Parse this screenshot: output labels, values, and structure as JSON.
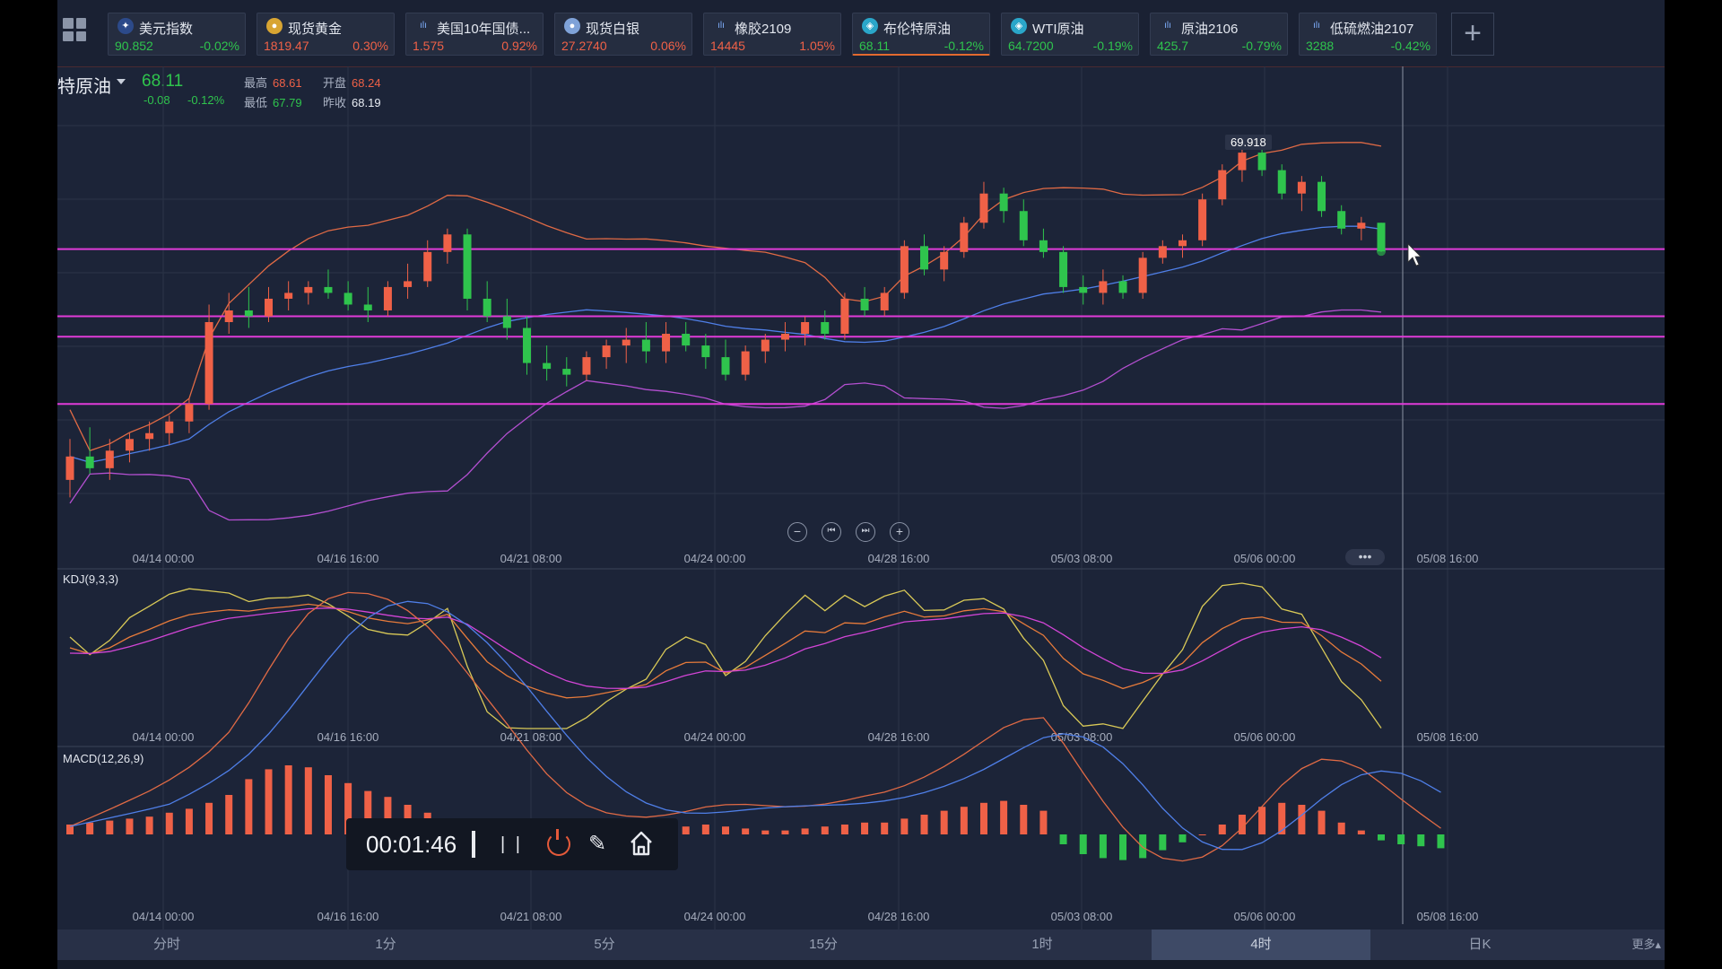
{
  "tickers": [
    {
      "name": "美元指数",
      "price": "90.852",
      "change": "-0.02%",
      "dir": "dn",
      "icon": "us-flag-icon"
    },
    {
      "name": "现货黄金",
      "price": "1819.47",
      "change": "0.30%",
      "dir": "up",
      "icon": "gold-coin-icon"
    },
    {
      "name": "美国10年国债...",
      "price": "1.575",
      "change": "0.92%",
      "dir": "up",
      "icon": "bar-chart-icon"
    },
    {
      "name": "现货白银",
      "price": "27.2740",
      "change": "0.06%",
      "dir": "up",
      "icon": "silver-coin-icon"
    },
    {
      "name": "橡胶2109",
      "price": "14445",
      "change": "1.05%",
      "dir": "up",
      "icon": "bar-chart-icon"
    },
    {
      "name": "布伦特原油",
      "price": "68.11",
      "change": "-0.12%",
      "dir": "dn",
      "icon": "oil-icon",
      "active": true
    },
    {
      "name": "WTI原油",
      "price": "64.7200",
      "change": "-0.19%",
      "dir": "dn",
      "icon": "oil-icon"
    },
    {
      "name": "原油2106",
      "price": "425.7",
      "change": "-0.79%",
      "dir": "dn",
      "icon": "bar-chart-icon"
    },
    {
      "name": "低硫燃油2107",
      "price": "3288",
      "change": "-0.42%",
      "dir": "dn",
      "icon": "bar-chart-icon"
    }
  ],
  "header": {
    "symbol": "特原油",
    "last": "68.11",
    "change": "-0.08",
    "change_pct": "-0.12%",
    "high_label": "最高",
    "high": "68.61",
    "open_label": "开盘",
    "open": "68.24",
    "low_label": "最低",
    "low": "67.79",
    "prev_label": "昨收",
    "prev": "68.19"
  },
  "chart_data": {
    "type": "candlestick",
    "title": "",
    "time_labels": [
      "04/14 00:00",
      "04/16 16:00",
      "04/21 08:00",
      "04/24 00:00",
      "04/28 16:00",
      "05/03 08:00",
      "05/06 00:00",
      "05/08 16:00"
    ],
    "max_label": "69.918",
    "indicators": {
      "kdj": "KDJ(9,3,3)",
      "macd": "MACD(12,26,9)"
    },
    "horizontal_lines_color": "#e03bd8",
    "up_color": "#ef6147",
    "down_color": "#2fc44d",
    "candles": [
      {
        "o": 64.2,
        "h": 64.9,
        "l": 63.9,
        "c": 64.6
      },
      {
        "o": 64.6,
        "h": 65.1,
        "l": 64.3,
        "c": 64.4
      },
      {
        "o": 64.4,
        "h": 64.9,
        "l": 64.2,
        "c": 64.7
      },
      {
        "o": 64.7,
        "h": 65.0,
        "l": 64.5,
        "c": 64.9
      },
      {
        "o": 64.9,
        "h": 65.2,
        "l": 64.7,
        "c": 65.0
      },
      {
        "o": 65.0,
        "h": 65.3,
        "l": 64.8,
        "c": 65.2
      },
      {
        "o": 65.2,
        "h": 65.6,
        "l": 65.0,
        "c": 65.5
      },
      {
        "o": 65.5,
        "h": 67.2,
        "l": 65.4,
        "c": 66.9
      },
      {
        "o": 66.9,
        "h": 67.4,
        "l": 66.7,
        "c": 67.1
      },
      {
        "o": 67.1,
        "h": 67.5,
        "l": 66.8,
        "c": 67.0
      },
      {
        "o": 67.0,
        "h": 67.5,
        "l": 66.9,
        "c": 67.3
      },
      {
        "o": 67.3,
        "h": 67.6,
        "l": 67.1,
        "c": 67.4
      },
      {
        "o": 67.4,
        "h": 67.6,
        "l": 67.2,
        "c": 67.5
      },
      {
        "o": 67.5,
        "h": 67.8,
        "l": 67.3,
        "c": 67.4
      },
      {
        "o": 67.4,
        "h": 67.6,
        "l": 67.1,
        "c": 67.2
      },
      {
        "o": 67.2,
        "h": 67.5,
        "l": 66.9,
        "c": 67.1
      },
      {
        "o": 67.1,
        "h": 67.6,
        "l": 67.0,
        "c": 67.5
      },
      {
        "o": 67.5,
        "h": 67.9,
        "l": 67.3,
        "c": 67.6
      },
      {
        "o": 67.6,
        "h": 68.3,
        "l": 67.5,
        "c": 68.1
      },
      {
        "o": 68.1,
        "h": 68.5,
        "l": 67.9,
        "c": 68.4
      },
      {
        "o": 68.4,
        "h": 68.5,
        "l": 67.1,
        "c": 67.3
      },
      {
        "o": 67.3,
        "h": 67.6,
        "l": 66.9,
        "c": 67.0
      },
      {
        "o": 67.0,
        "h": 67.3,
        "l": 66.6,
        "c": 66.8
      },
      {
        "o": 66.8,
        "h": 67.0,
        "l": 66.0,
        "c": 66.2
      },
      {
        "o": 66.2,
        "h": 66.5,
        "l": 65.9,
        "c": 66.1
      },
      {
        "o": 66.1,
        "h": 66.3,
        "l": 65.8,
        "c": 66.0
      },
      {
        "o": 66.0,
        "h": 66.4,
        "l": 65.9,
        "c": 66.3
      },
      {
        "o": 66.3,
        "h": 66.6,
        "l": 66.1,
        "c": 66.5
      },
      {
        "o": 66.5,
        "h": 66.8,
        "l": 66.2,
        "c": 66.6
      },
      {
        "o": 66.6,
        "h": 66.9,
        "l": 66.2,
        "c": 66.4
      },
      {
        "o": 66.4,
        "h": 66.9,
        "l": 66.2,
        "c": 66.7
      },
      {
        "o": 66.7,
        "h": 66.9,
        "l": 66.4,
        "c": 66.5
      },
      {
        "o": 66.5,
        "h": 66.7,
        "l": 66.1,
        "c": 66.3
      },
      {
        "o": 66.3,
        "h": 66.6,
        "l": 65.9,
        "c": 66.0
      },
      {
        "o": 66.0,
        "h": 66.5,
        "l": 65.9,
        "c": 66.4
      },
      {
        "o": 66.4,
        "h": 66.7,
        "l": 66.2,
        "c": 66.6
      },
      {
        "o": 66.6,
        "h": 66.9,
        "l": 66.4,
        "c": 66.7
      },
      {
        "o": 66.7,
        "h": 67.0,
        "l": 66.5,
        "c": 66.9
      },
      {
        "o": 66.9,
        "h": 67.1,
        "l": 66.6,
        "c": 66.7
      },
      {
        "o": 66.7,
        "h": 67.4,
        "l": 66.6,
        "c": 67.3
      },
      {
        "o": 67.3,
        "h": 67.5,
        "l": 67.0,
        "c": 67.1
      },
      {
        "o": 67.1,
        "h": 67.5,
        "l": 67.0,
        "c": 67.4
      },
      {
        "o": 67.4,
        "h": 68.3,
        "l": 67.3,
        "c": 68.2
      },
      {
        "o": 68.2,
        "h": 68.4,
        "l": 67.7,
        "c": 67.8
      },
      {
        "o": 67.8,
        "h": 68.2,
        "l": 67.6,
        "c": 68.1
      },
      {
        "o": 68.1,
        "h": 68.7,
        "l": 68.0,
        "c": 68.6
      },
      {
        "o": 68.6,
        "h": 69.3,
        "l": 68.5,
        "c": 69.1
      },
      {
        "o": 69.1,
        "h": 69.2,
        "l": 68.6,
        "c": 68.8
      },
      {
        "o": 68.8,
        "h": 69.0,
        "l": 68.2,
        "c": 68.3
      },
      {
        "o": 68.3,
        "h": 68.5,
        "l": 68.0,
        "c": 68.1
      },
      {
        "o": 68.1,
        "h": 68.2,
        "l": 67.4,
        "c": 67.5
      },
      {
        "o": 67.5,
        "h": 67.7,
        "l": 67.2,
        "c": 67.4
      },
      {
        "o": 67.4,
        "h": 67.8,
        "l": 67.2,
        "c": 67.6
      },
      {
        "o": 67.6,
        "h": 67.7,
        "l": 67.3,
        "c": 67.4
      },
      {
        "o": 67.4,
        "h": 68.1,
        "l": 67.3,
        "c": 68.0
      },
      {
        "o": 68.0,
        "h": 68.3,
        "l": 67.9,
        "c": 68.2
      },
      {
        "o": 68.2,
        "h": 68.4,
        "l": 68.0,
        "c": 68.3
      },
      {
        "o": 68.3,
        "h": 69.1,
        "l": 68.2,
        "c": 69.0
      },
      {
        "o": 69.0,
        "h": 69.6,
        "l": 68.9,
        "c": 69.5
      },
      {
        "o": 69.5,
        "h": 69.9,
        "l": 69.3,
        "c": 69.8
      },
      {
        "o": 69.8,
        "h": 69.9,
        "l": 69.4,
        "c": 69.5
      },
      {
        "o": 69.5,
        "h": 69.6,
        "l": 69.0,
        "c": 69.1
      },
      {
        "o": 69.1,
        "h": 69.4,
        "l": 68.8,
        "c": 69.3
      },
      {
        "o": 69.3,
        "h": 69.4,
        "l": 68.7,
        "c": 68.8
      },
      {
        "o": 68.8,
        "h": 68.9,
        "l": 68.4,
        "c": 68.5
      },
      {
        "o": 68.5,
        "h": 68.7,
        "l": 68.3,
        "c": 68.6
      },
      {
        "o": 68.6,
        "h": 68.6,
        "l": 68.1,
        "c": 68.11
      }
    ],
    "price_lines": [
      68.15,
      67.0,
      66.65,
      65.5
    ],
    "macd_hist": [
      0.05,
      0.06,
      0.07,
      0.08,
      0.09,
      0.11,
      0.13,
      0.16,
      0.2,
      0.28,
      0.33,
      0.35,
      0.34,
      0.3,
      0.26,
      0.22,
      0.19,
      0.15,
      0.11,
      0.06,
      0.02,
      -0.01,
      -0.03,
      -0.06,
      -0.07,
      -0.06,
      -0.04,
      -0.02,
      0.0,
      0.01,
      0.03,
      0.04,
      0.05,
      0.04,
      0.03,
      0.02,
      0.02,
      0.03,
      0.04,
      0.05,
      0.06,
      0.06,
      0.08,
      0.1,
      0.12,
      0.14,
      0.16,
      0.17,
      0.15,
      0.12,
      -0.05,
      -0.1,
      -0.12,
      -0.13,
      -0.12,
      -0.08,
      -0.04,
      0.0,
      0.05,
      0.1,
      0.14,
      0.16,
      0.15,
      0.12,
      0.06,
      0.02,
      -0.03,
      -0.05,
      -0.06,
      -0.07
    ]
  },
  "controls": {
    "zoom_out": "−",
    "prev": "⏮",
    "next": "⏭",
    "zoom_in": "+",
    "more_dots": "•••"
  },
  "recorder": {
    "time": "00:01:46",
    "pause": "| |",
    "pen": "✎"
  },
  "periods": [
    "分时",
    "1分",
    "5分",
    "15分",
    "1时",
    "4时",
    "日K"
  ],
  "active_period": "4时",
  "more_label": "更多▴"
}
